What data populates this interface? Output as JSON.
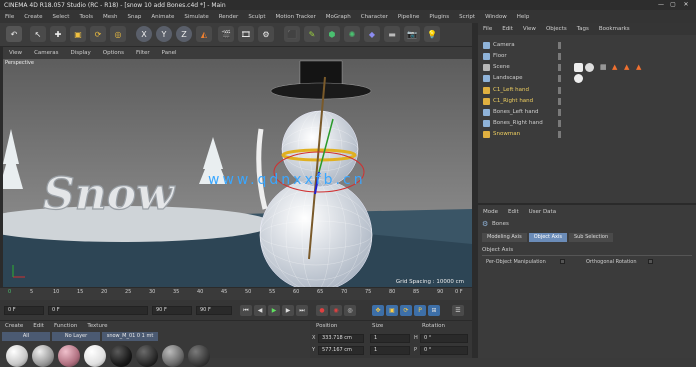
{
  "window": {
    "title": "CINEMA 4D R18.057 Studio (RC - R18) - [snow 10 add Bones.c4d *] - Main",
    "controls": [
      "—",
      "▢",
      "✕"
    ]
  },
  "menubar": [
    "File",
    "Create",
    "Select",
    "Tools",
    "Mesh",
    "Snap",
    "Animate",
    "Simulate",
    "Render",
    "Sculpt",
    "Motion Tracker",
    "MoGraph",
    "Character",
    "Pipeline",
    "Plugins",
    "Script",
    "Window",
    "Help"
  ],
  "viewport": {
    "menu": [
      "View",
      "Cameras",
      "Display",
      "Options",
      "Filter",
      "Panel"
    ],
    "label": "Perspective",
    "grid_spacing": "Grid Spacing : 10000 cm",
    "scene_text": "Snow",
    "watermark": "www.qdnxxfb.cn"
  },
  "timeline": {
    "ticks": [
      "0",
      "5",
      "10",
      "15",
      "20",
      "25",
      "30",
      "35",
      "40",
      "45",
      "50",
      "55",
      "60",
      "65",
      "70",
      "75",
      "80",
      "85",
      "90"
    ],
    "end_label": "0 F"
  },
  "transport": {
    "start_frame": "0 F",
    "current_frame": "0 F",
    "end_frame": "90 F",
    "max_frame": "90 F"
  },
  "material_manager": {
    "menu": [
      "Create",
      "Edit",
      "Function",
      "Texture"
    ],
    "filters": [
      "All",
      "No Layer",
      "snow_M_01 0 1 mt"
    ],
    "balls": [
      "#c9c9c9",
      "#9a9a9a",
      "#b07080",
      "#e0e0e0",
      "#1a1a1a",
      "#2a2a2a",
      "#6a6a6a",
      "#3a3a3a"
    ]
  },
  "coordinates": {
    "headers": [
      "Position",
      "Size",
      "Rotation"
    ],
    "rows": [
      {
        "axis": "X",
        "pos": "333.718 cm",
        "size": "1",
        "rot": "0 °",
        "rot_axis": "H"
      },
      {
        "axis": "Y",
        "pos": "577.167 cm",
        "size": "1",
        "rot": "0 °",
        "rot_axis": "P"
      }
    ]
  },
  "object_manager": {
    "menu": [
      "File",
      "Edit",
      "View",
      "Objects",
      "Tags",
      "Bookmarks"
    ],
    "objects": [
      {
        "name": "Camera",
        "color": "#8fb3d9"
      },
      {
        "name": "Floor",
        "color": "#8fb3d9"
      },
      {
        "name": "Scene",
        "color": "#b8b8b8"
      },
      {
        "name": "Landscape",
        "color": "#8fb3d9"
      },
      {
        "name": "C1_Left hand",
        "color": "#e0b040"
      },
      {
        "name": "C1_Right hand",
        "color": "#e0b040"
      },
      {
        "name": "Bones_Left hand",
        "color": "#8fb3d9"
      },
      {
        "name": "Bones_Right hand",
        "color": "#8fb3d9"
      },
      {
        "name": "Snowman",
        "color": "#e0b040"
      }
    ]
  },
  "attributes": {
    "menu": [
      "Mode",
      "Edit",
      "User Data"
    ],
    "object_label": "Bones",
    "tabs": [
      "Modeling Axis",
      "Object Axis",
      "Sub Selection"
    ],
    "section": "Object Axis",
    "options": [
      "Per-Object Manipulation",
      "Orthogonal Rotation"
    ]
  }
}
